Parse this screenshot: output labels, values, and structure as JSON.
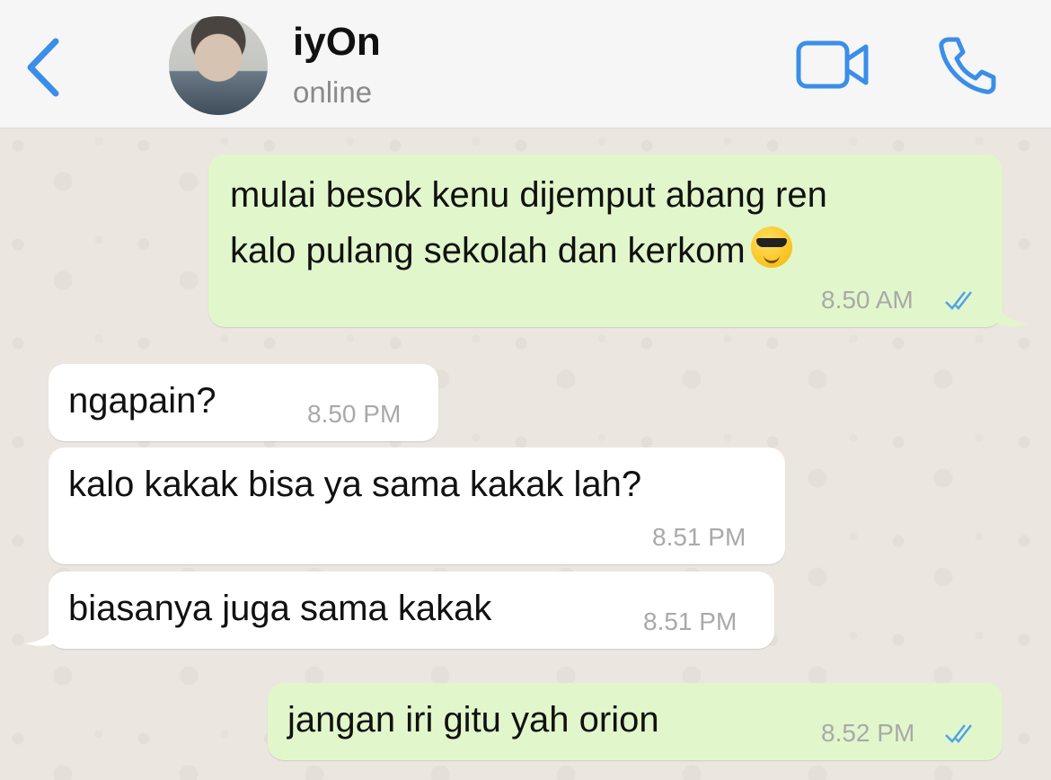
{
  "header": {
    "contact_name": "iyOn",
    "status": "online",
    "back_icon": "chevron-left-icon",
    "video_icon": "video-camera-icon",
    "call_icon": "phone-icon",
    "accent_color": "#3b8ee8"
  },
  "messages": [
    {
      "direction": "outgoing",
      "line1": "mulai besok kenu dijemput abang ren",
      "line2": "kalo pulang sekolah dan kerkom",
      "emoji": "smiling-face-with-sunglasses",
      "time": "8.50 AM",
      "read": true
    },
    {
      "direction": "incoming",
      "text": "ngapain?",
      "time": "8.50 PM"
    },
    {
      "direction": "incoming",
      "text": "kalo kakak bisa ya sama kakak lah?",
      "time": "8.51 PM"
    },
    {
      "direction": "incoming",
      "text": "biasanya juga sama kakak",
      "time": "8.51 PM"
    },
    {
      "direction": "outgoing",
      "text": "jangan iri gitu yah orion",
      "time": "8.52 PM",
      "read": true
    }
  ],
  "colors": {
    "outgoing_bubble": "#e1f7cb",
    "incoming_bubble": "#ffffff",
    "read_tick": "#4fa3e8"
  }
}
